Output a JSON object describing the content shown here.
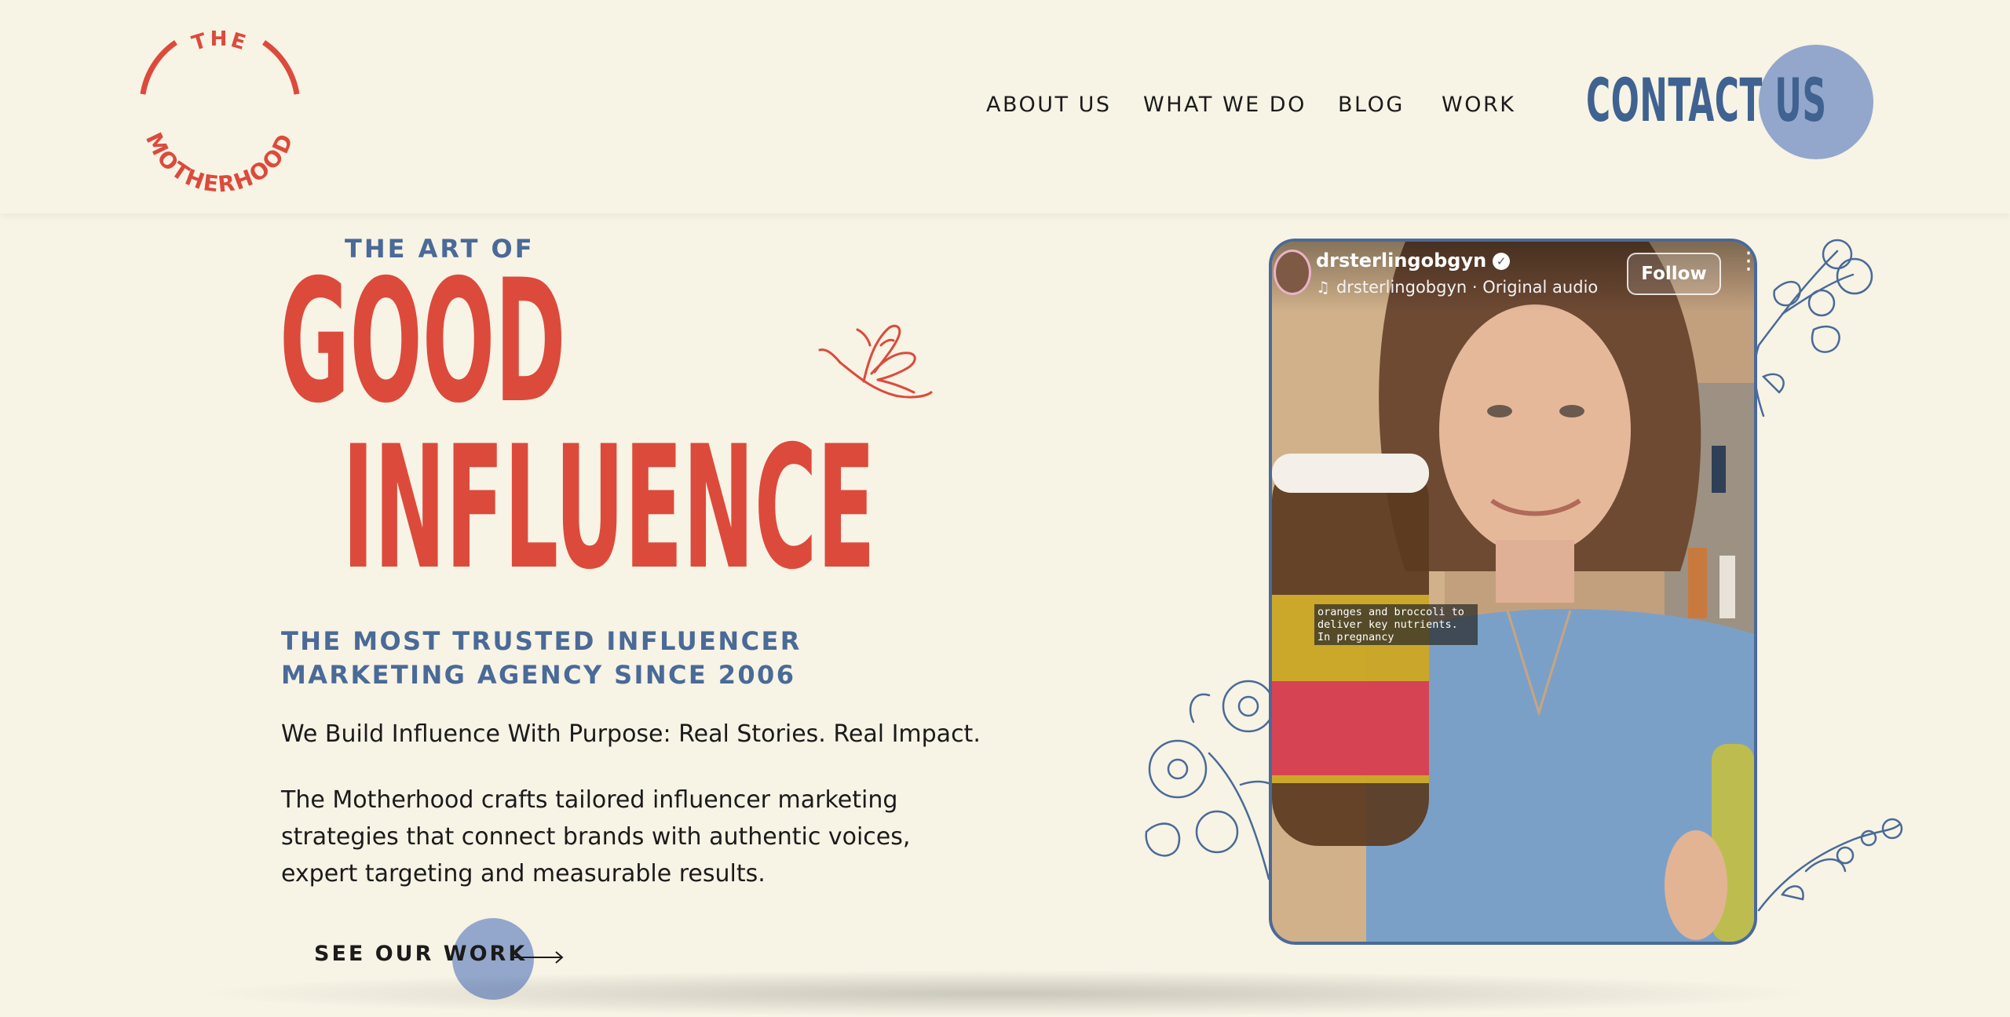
{
  "header": {
    "logo": {
      "top_text": "THE",
      "bottom_text": "MOTHERHOOD",
      "color": "#dc4a3b"
    },
    "nav": [
      {
        "label": "ABOUT US"
      },
      {
        "label": "WHAT WE DO"
      },
      {
        "label": "BLOG"
      },
      {
        "label": "WORK"
      }
    ],
    "contact_label": "CONTACT US"
  },
  "hero": {
    "eyebrow": "THE ART OF",
    "headline_1": "GOOD",
    "headline_2": "INFLUENCE",
    "tagline_line1": "THE MOST TRUSTED INFLUENCER",
    "tagline_line2": "MARKETING AGENCY SINCE 2006",
    "subheading": "We Build Influence With Purpose: Real Stories. Real Impact.",
    "paragraph_line1": "The Motherhood crafts tailored influencer marketing",
    "paragraph_line2": "strategies that connect brands with authentic voices,",
    "paragraph_line3": "expert targeting and measurable results.",
    "cta_label": "SEE OUR WORK",
    "cta_icon": "arrow-right-icon"
  },
  "video": {
    "username": "drsterlingobgyn",
    "audio": "drsterlingobgyn · Original audio",
    "follow_label": "Follow",
    "more_icon": "more-dots-icon",
    "caption": "oranges and broccoli to\ndeliver key nutrients.\nIn pregnancy"
  },
  "colors": {
    "background": "#f7f3e5",
    "accent_red": "#dc4a3b",
    "accent_blue": "#4a6a97",
    "circle_blue": "#93a7cc"
  }
}
